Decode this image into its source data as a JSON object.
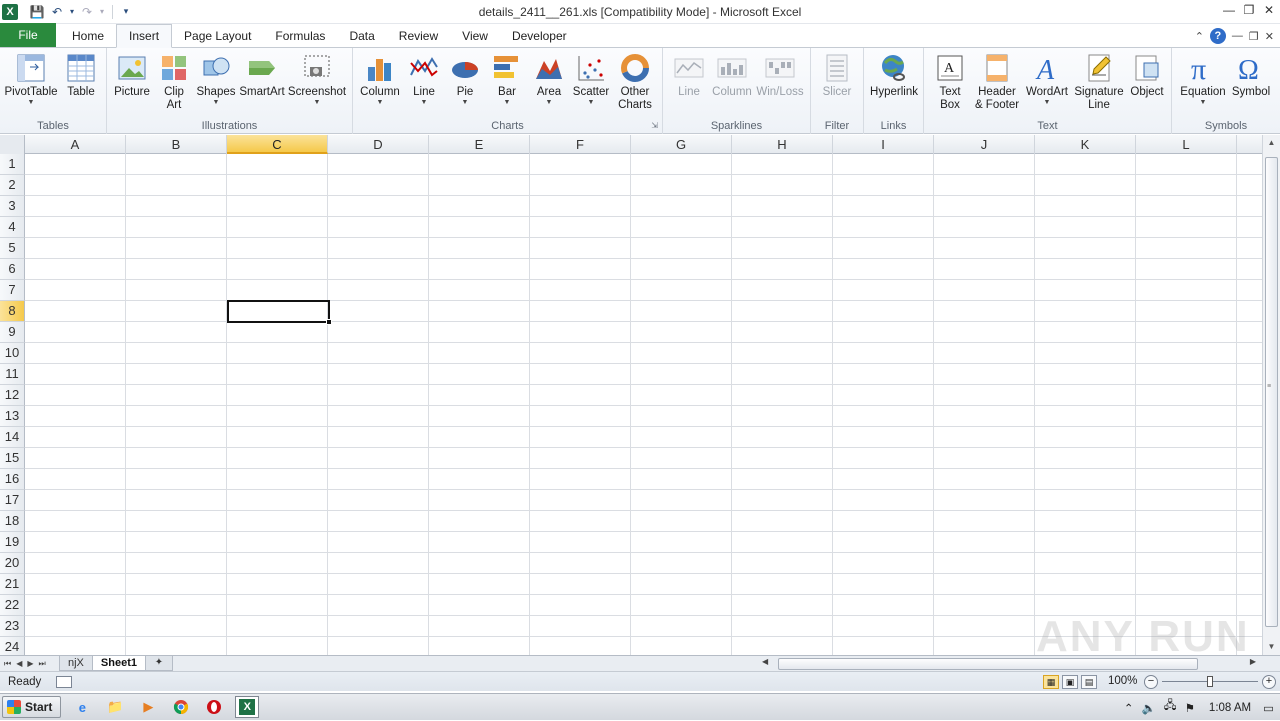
{
  "window": {
    "title": "details_2411__261.xls  [Compatibility Mode]  -  Microsoft Excel"
  },
  "tabs": [
    "File",
    "Home",
    "Insert",
    "Page Layout",
    "Formulas",
    "Data",
    "Review",
    "View",
    "Developer"
  ],
  "active_tab": "Insert",
  "ribbon": {
    "tables": {
      "label": "Tables",
      "pivottable": "PivotTable",
      "table": "Table"
    },
    "illustrations": {
      "label": "Illustrations",
      "picture": "Picture",
      "clip_art": "Clip\nArt",
      "shapes": "Shapes",
      "smartart": "SmartArt",
      "screenshot": "Screenshot"
    },
    "charts": {
      "label": "Charts",
      "column": "Column",
      "line": "Line",
      "pie": "Pie",
      "bar": "Bar",
      "area": "Area",
      "scatter": "Scatter",
      "other": "Other\nCharts"
    },
    "sparklines": {
      "label": "Sparklines",
      "line": "Line",
      "column": "Column",
      "winloss": "Win/Loss"
    },
    "filter": {
      "label": "Filter",
      "slicer": "Slicer"
    },
    "links": {
      "label": "Links",
      "hyperlink": "Hyperlink"
    },
    "text": {
      "label": "Text",
      "textbox": "Text\nBox",
      "header_footer": "Header\n& Footer",
      "wordart": "WordArt",
      "signature": "Signature\nLine",
      "object": "Object"
    },
    "symbols": {
      "label": "Symbols",
      "equation": "Equation",
      "symbol": "Symbol"
    }
  },
  "columns": [
    "A",
    "B",
    "C",
    "D",
    "E",
    "F",
    "G",
    "H",
    "I",
    "J",
    "K",
    "L"
  ],
  "rows": [
    "1",
    "2",
    "3",
    "4",
    "5",
    "6",
    "7",
    "8",
    "9",
    "10",
    "11",
    "12",
    "13",
    "14",
    "15",
    "16",
    "17",
    "18",
    "19",
    "20",
    "21",
    "22",
    "23",
    "24"
  ],
  "selected_column": "C",
  "selected_row": "8",
  "sheets": [
    "njX",
    "Sheet1"
  ],
  "active_sheet": "Sheet1",
  "status": {
    "text": "Ready",
    "zoom": "100%"
  },
  "zoom_slider_level": 0.5,
  "taskbar": {
    "start_label": "Start",
    "clock": "1:08 AM"
  },
  "watermark": "ANY RUN"
}
